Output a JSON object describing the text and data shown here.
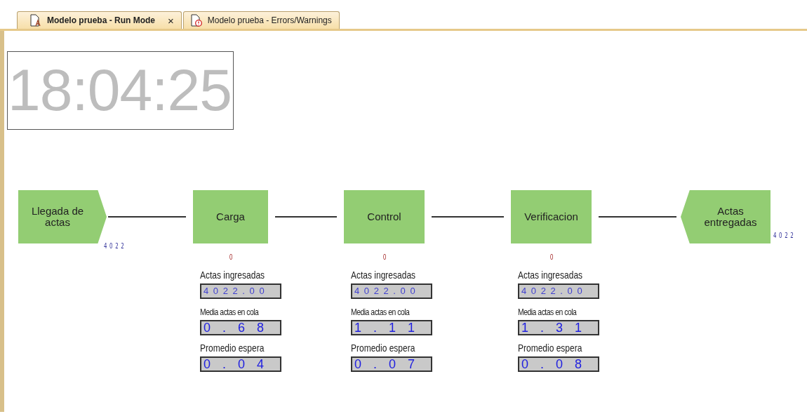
{
  "tabs": [
    {
      "kind": "run",
      "label": "Modelo prueba - Run Mode",
      "selected": true,
      "close": "×"
    },
    {
      "kind": "errors",
      "label": "Modelo prueba - Errors/Warnings",
      "selected": false
    }
  ],
  "clock": "18:04:25",
  "nodes": [
    {
      "kind": "source",
      "label": "Llegada de actas",
      "counter": "4 0 2 2"
    },
    {
      "kind": "activity",
      "label": "Carga",
      "queue": "0",
      "stats": [
        {
          "label": "Actas ingresadas",
          "value": "4 0 2 2 . 0 0"
        },
        {
          "label": "Media actas en cola",
          "value": "0 . 6 8"
        },
        {
          "label": "Promedio espera",
          "value": "0 . 0 4"
        }
      ]
    },
    {
      "kind": "activity",
      "label": "Control",
      "queue": "0",
      "stats": [
        {
          "label": "Actas ingresadas",
          "value": "4 0 2 2 . 0 0"
        },
        {
          "label": "Media actas en cola",
          "value": "1 . 1 1"
        },
        {
          "label": "Promedio espera",
          "value": "0 . 0 7"
        }
      ]
    },
    {
      "kind": "activity",
      "label": "Verificacion",
      "queue": "0",
      "stats": [
        {
          "label": "Actas ingresadas",
          "value": "4 0 2 2 . 0 0"
        },
        {
          "label": "Media actas en cola",
          "value": "1 . 3 1"
        },
        {
          "label": "Promedio espera",
          "value": "0 . 0 8"
        }
      ]
    },
    {
      "kind": "sink",
      "label": "Actas entregadas",
      "counter": "4 0 2 2"
    }
  ]
}
